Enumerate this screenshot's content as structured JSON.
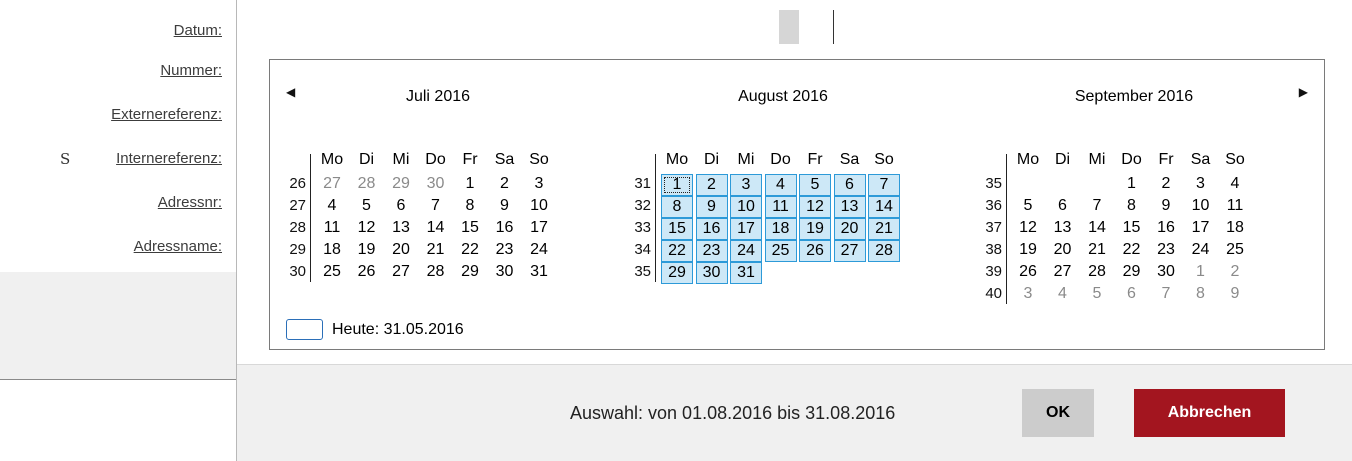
{
  "form": {
    "labels": [
      "Datum:",
      "Nummer:",
      "Externereferenz:",
      "Internereferenz:",
      "Adressnr:",
      "Adressname:"
    ],
    "marker": "S"
  },
  "calendar": {
    "prev_icon": "triangle-left",
    "next_icon": "triangle-right",
    "weekday_headers": [
      "Mo",
      "Di",
      "Mi",
      "Do",
      "Fr",
      "Sa",
      "So"
    ],
    "months": [
      {
        "title": "Juli 2016",
        "weeks": [
          {
            "no": "26",
            "days": [
              {
                "d": "27",
                "o": true
              },
              {
                "d": "28",
                "o": true
              },
              {
                "d": "29",
                "o": true
              },
              {
                "d": "30",
                "o": true
              },
              {
                "d": "1"
              },
              {
                "d": "2"
              },
              {
                "d": "3"
              }
            ]
          },
          {
            "no": "27",
            "days": [
              {
                "d": "4"
              },
              {
                "d": "5"
              },
              {
                "d": "6"
              },
              {
                "d": "7"
              },
              {
                "d": "8"
              },
              {
                "d": "9"
              },
              {
                "d": "10"
              }
            ]
          },
          {
            "no": "28",
            "days": [
              {
                "d": "11"
              },
              {
                "d": "12"
              },
              {
                "d": "13"
              },
              {
                "d": "14"
              },
              {
                "d": "15"
              },
              {
                "d": "16"
              },
              {
                "d": "17"
              }
            ]
          },
          {
            "no": "29",
            "days": [
              {
                "d": "18"
              },
              {
                "d": "19"
              },
              {
                "d": "20"
              },
              {
                "d": "21"
              },
              {
                "d": "22"
              },
              {
                "d": "23"
              },
              {
                "d": "24"
              }
            ]
          },
          {
            "no": "30",
            "days": [
              {
                "d": "25"
              },
              {
                "d": "26"
              },
              {
                "d": "27"
              },
              {
                "d": "28"
              },
              {
                "d": "29"
              },
              {
                "d": "30"
              },
              {
                "d": "31"
              }
            ]
          }
        ]
      },
      {
        "title": "August 2016",
        "weeks": [
          {
            "no": "31",
            "days": [
              {
                "d": "1",
                "s": true,
                "f": true
              },
              {
                "d": "2",
                "s": true
              },
              {
                "d": "3",
                "s": true
              },
              {
                "d": "4",
                "s": true
              },
              {
                "d": "5",
                "s": true
              },
              {
                "d": "6",
                "s": true
              },
              {
                "d": "7",
                "s": true
              }
            ]
          },
          {
            "no": "32",
            "days": [
              {
                "d": "8",
                "s": true
              },
              {
                "d": "9",
                "s": true
              },
              {
                "d": "10",
                "s": true
              },
              {
                "d": "11",
                "s": true
              },
              {
                "d": "12",
                "s": true
              },
              {
                "d": "13",
                "s": true
              },
              {
                "d": "14",
                "s": true
              }
            ]
          },
          {
            "no": "33",
            "days": [
              {
                "d": "15",
                "s": true
              },
              {
                "d": "16",
                "s": true
              },
              {
                "d": "17",
                "s": true
              },
              {
                "d": "18",
                "s": true
              },
              {
                "d": "19",
                "s": true
              },
              {
                "d": "20",
                "s": true
              },
              {
                "d": "21",
                "s": true
              }
            ]
          },
          {
            "no": "34",
            "days": [
              {
                "d": "22",
                "s": true
              },
              {
                "d": "23",
                "s": true
              },
              {
                "d": "24",
                "s": true
              },
              {
                "d": "25",
                "s": true
              },
              {
                "d": "26",
                "s": true
              },
              {
                "d": "27",
                "s": true
              },
              {
                "d": "28",
                "s": true
              }
            ]
          },
          {
            "no": "35",
            "days": [
              {
                "d": "29",
                "s": true
              },
              {
                "d": "30",
                "s": true
              },
              {
                "d": "31",
                "s": true
              }
            ]
          }
        ]
      },
      {
        "title": "September 2016",
        "weeks": [
          {
            "no": "35",
            "days": [
              null,
              null,
              null,
              {
                "d": "1"
              },
              {
                "d": "2"
              },
              {
                "d": "3"
              },
              {
                "d": "4"
              }
            ]
          },
          {
            "no": "36",
            "days": [
              {
                "d": "5"
              },
              {
                "d": "6"
              },
              {
                "d": "7"
              },
              {
                "d": "8"
              },
              {
                "d": "9"
              },
              {
                "d": "10"
              },
              {
                "d": "11"
              }
            ]
          },
          {
            "no": "37",
            "days": [
              {
                "d": "12"
              },
              {
                "d": "13"
              },
              {
                "d": "14"
              },
              {
                "d": "15"
              },
              {
                "d": "16"
              },
              {
                "d": "17"
              },
              {
                "d": "18"
              }
            ]
          },
          {
            "no": "38",
            "days": [
              {
                "d": "19"
              },
              {
                "d": "20"
              },
              {
                "d": "21"
              },
              {
                "d": "22"
              },
              {
                "d": "23"
              },
              {
                "d": "24"
              },
              {
                "d": "25"
              }
            ]
          },
          {
            "no": "39",
            "days": [
              {
                "d": "26"
              },
              {
                "d": "27"
              },
              {
                "d": "28"
              },
              {
                "d": "29"
              },
              {
                "d": "30"
              },
              {
                "d": "1",
                "o": true
              },
              {
                "d": "2",
                "o": true
              }
            ]
          },
          {
            "no": "40",
            "days": [
              {
                "d": "3",
                "o": true
              },
              {
                "d": "4",
                "o": true
              },
              {
                "d": "5",
                "o": true
              },
              {
                "d": "6",
                "o": true
              },
              {
                "d": "7",
                "o": true
              },
              {
                "d": "8",
                "o": true
              },
              {
                "d": "9",
                "o": true
              }
            ]
          }
        ]
      }
    ],
    "today_label": "Heute: 31.05.2016"
  },
  "footer": {
    "selection_text": "Auswahl: von 01.08.2016 bis 31.08.2016",
    "ok_label": "OK",
    "cancel_label": "Abbrechen"
  },
  "colors": {
    "selection_fill": "#cde8f7",
    "selection_border": "#2d9ad8",
    "cancel_button": "#a3151f",
    "ok_button": "#cccccc"
  }
}
